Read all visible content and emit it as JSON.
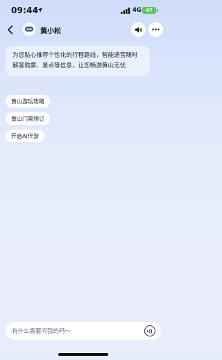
{
  "status_bar": {
    "time": "09:44",
    "network": "4G",
    "battery": "47"
  },
  "header": {
    "title": "黄小松",
    "icons": [
      "back-icon",
      "avatar",
      "speaker-icon",
      "more-icon"
    ]
  },
  "messages": {
    "intro": "为您贴心推荐个性化的行程路线，智能语音随时解答购票、景点等信息，让您畅游黄山无忧"
  },
  "suggestions": [
    {
      "label": "黄山游玩攻略"
    },
    {
      "label": "黄山门票预订"
    },
    {
      "label": "开启AI伴游"
    }
  ],
  "input": {
    "placeholder": "有什么需要问我的吗～"
  },
  "colors": {
    "bg_top": "#cfdcfa",
    "bg_bottom": "#e7ecfb",
    "battery": "#58c95a"
  }
}
